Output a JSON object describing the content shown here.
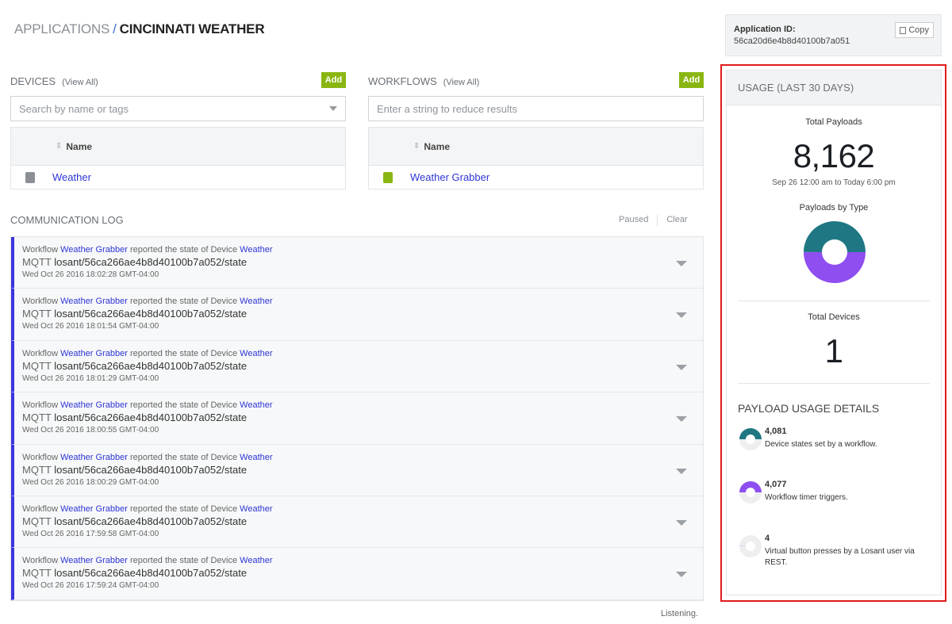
{
  "breadcrumb": {
    "root": "APPLICATIONS",
    "separator": "/",
    "current": "CINCINNATI WEATHER"
  },
  "devices": {
    "title": "DEVICES",
    "view_all": "(View All)",
    "add_label": "Add",
    "search_placeholder": "Search by name or tags",
    "column_name": "Name",
    "rows": [
      {
        "name": "Weather",
        "color": "#8c8f96"
      }
    ]
  },
  "workflows": {
    "title": "WORKFLOWS",
    "view_all": "(View All)",
    "add_label": "Add",
    "search_placeholder": "Enter a string to reduce results",
    "column_name": "Name",
    "rows": [
      {
        "name": "Weather Grabber",
        "color": "#8ab613"
      }
    ]
  },
  "log": {
    "title": "COMMUNICATION LOG",
    "paused_label": "Paused",
    "clear_label": "Clear",
    "listening": "Listening.",
    "entries": [
      {
        "prefix": "Workflow",
        "workflow": "Weather Grabber",
        "middle": "reported the state of Device",
        "device": "Weather",
        "proto": "MQTT",
        "topic": "losant/56ca266ae4b8d40100b7a052/state",
        "time": "Wed Oct 26 2016 18:02:28 GMT-04:00"
      },
      {
        "prefix": "Workflow",
        "workflow": "Weather Grabber",
        "middle": "reported the state of Device",
        "device": "Weather",
        "proto": "MQTT",
        "topic": "losant/56ca266ae4b8d40100b7a052/state",
        "time": "Wed Oct 26 2016 18:01:54 GMT-04:00"
      },
      {
        "prefix": "Workflow",
        "workflow": "Weather Grabber",
        "middle": "reported the state of Device",
        "device": "Weather",
        "proto": "MQTT",
        "topic": "losant/56ca266ae4b8d40100b7a052/state",
        "time": "Wed Oct 26 2016 18:01:29 GMT-04:00"
      },
      {
        "prefix": "Workflow",
        "workflow": "Weather Grabber",
        "middle": "reported the state of Device",
        "device": "Weather",
        "proto": "MQTT",
        "topic": "losant/56ca266ae4b8d40100b7a052/state",
        "time": "Wed Oct 26 2016 18:00:55 GMT-04:00"
      },
      {
        "prefix": "Workflow",
        "workflow": "Weather Grabber",
        "middle": "reported the state of Device",
        "device": "Weather",
        "proto": "MQTT",
        "topic": "losant/56ca266ae4b8d40100b7a052/state",
        "time": "Wed Oct 26 2016 18:00:29 GMT-04:00"
      },
      {
        "prefix": "Workflow",
        "workflow": "Weather Grabber",
        "middle": "reported the state of Device",
        "device": "Weather",
        "proto": "MQTT",
        "topic": "losant/56ca266ae4b8d40100b7a052/state",
        "time": "Wed Oct 26 2016 17:59:58 GMT-04:00"
      },
      {
        "prefix": "Workflow",
        "workflow": "Weather Grabber",
        "middle": "reported the state of Device",
        "device": "Weather",
        "proto": "MQTT",
        "topic": "losant/56ca266ae4b8d40100b7a052/state",
        "time": "Wed Oct 26 2016 17:59:24 GMT-04:00"
      }
    ]
  },
  "app_id": {
    "label": "Application ID:",
    "value": "56ca20d6e4b8d40100b7a051",
    "copy_label": "Copy"
  },
  "usage": {
    "title": "USAGE (LAST 30 DAYS)",
    "total_payloads_label": "Total Payloads",
    "total_payloads": "8,162",
    "range": "Sep 26 12:00 am to Today 6:00 pm",
    "by_type_label": "Payloads by Type",
    "total_devices_label": "Total Devices",
    "total_devices": "1",
    "details_title": "PAYLOAD USAGE DETAILS",
    "details": [
      {
        "value": "4,081",
        "desc": "Device states set by a workflow.",
        "color": "#1e7783",
        "count": 4081
      },
      {
        "value": "4,077",
        "desc": "Workflow timer triggers.",
        "color": "#8e4ef0",
        "count": 4077
      },
      {
        "value": "4",
        "desc": "Virtual button presses by a Losant user via REST.",
        "color": "#bcd3f5",
        "count": 4
      }
    ]
  }
}
